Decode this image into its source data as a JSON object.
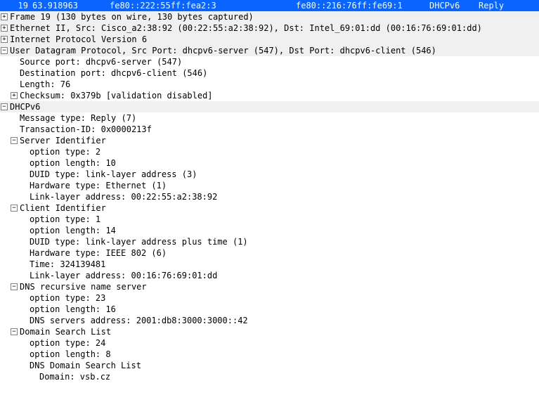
{
  "packet": {
    "no": "19",
    "time": "63.918963",
    "src": "fe80::222:55ff:fea2:3",
    "dst": "fe80::216:76ff:fe69:1",
    "proto": "DHCPv6",
    "info": "Reply"
  },
  "frame": "Frame 19 (130 bytes on wire, 130 bytes captured)",
  "eth": "Ethernet II, Src: Cisco_a2:38:92 (00:22:55:a2:38:92), Dst: Intel_69:01:dd (00:16:76:69:01:dd)",
  "ipv6": "Internet Protocol Version 6",
  "udp": {
    "summary": "User Datagram Protocol, Src Port: dhcpv6-server (547), Dst Port: dhcpv6-client (546)",
    "srcport": "Source port: dhcpv6-server (547)",
    "dstport": "Destination port: dhcpv6-client (546)",
    "length": "Length: 76",
    "checksum": "Checksum: 0x379b [validation disabled]"
  },
  "dhcpv6": {
    "title": "DHCPv6",
    "msgtype": "Message type: Reply (7)",
    "xid": "Transaction-ID: 0x0000213f",
    "server_id": {
      "title": "Server Identifier",
      "opt_type": "option type: 2",
      "opt_len": "option length: 10",
      "duid_type": "DUID type: link-layer address (3)",
      "hw_type": "Hardware type: Ethernet (1)",
      "ll_addr": "Link-layer address: 00:22:55:a2:38:92"
    },
    "client_id": {
      "title": "Client Identifier",
      "opt_type": "option type: 1",
      "opt_len": "option length: 14",
      "duid_type": "DUID type: link-layer address plus time (1)",
      "hw_type": "Hardware type: IEEE 802 (6)",
      "time": "Time: 324139481",
      "ll_addr": "Link-layer address: 00:16:76:69:01:dd"
    },
    "dns": {
      "title": "DNS recursive name server",
      "opt_type": "option type: 23",
      "opt_len": "option length: 16",
      "addr": "DNS servers address: 2001:db8:3000:3000::42"
    },
    "dsl": {
      "title": "Domain Search List",
      "opt_type": "option type: 24",
      "opt_len": "option length: 8",
      "list": "DNS Domain Search List",
      "domain": "Domain: vsb.cz"
    }
  }
}
